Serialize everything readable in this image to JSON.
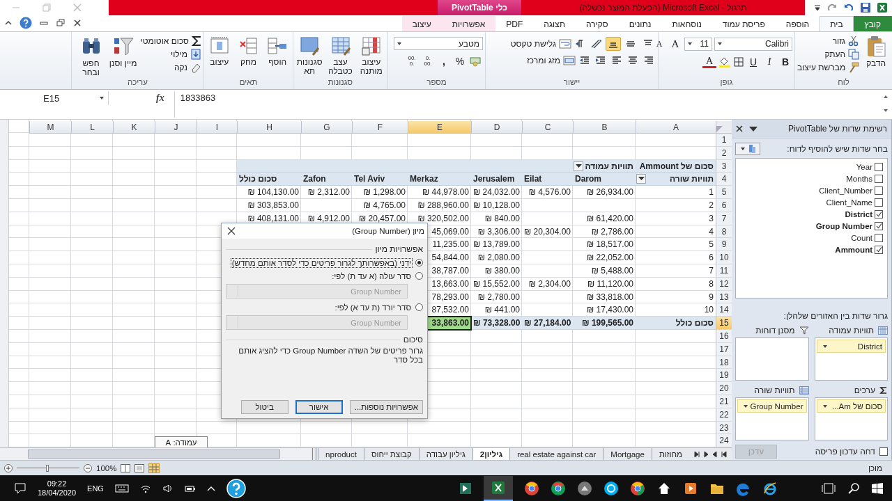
{
  "window": {
    "title": "תרגול - Microsoft Excel (הפעלת המוצר נכשלה)",
    "context_tab": "כלי PivotTable"
  },
  "tabs": [
    {
      "label": "קובץ",
      "kind": "file",
      "selected": false
    },
    {
      "label": "בית",
      "kind": "normal",
      "selected": true
    },
    {
      "label": "הוספה",
      "kind": "normal",
      "selected": false
    },
    {
      "label": "פריסת עמוד",
      "kind": "normal",
      "selected": false
    },
    {
      "label": "נוסחאות",
      "kind": "normal",
      "selected": false
    },
    {
      "label": "נתונים",
      "kind": "normal",
      "selected": false
    },
    {
      "label": "סקירה",
      "kind": "normal",
      "selected": false
    },
    {
      "label": "תצוגה",
      "kind": "normal",
      "selected": false
    },
    {
      "label": "PDF",
      "kind": "normal",
      "selected": false
    },
    {
      "label": "אפשרויות",
      "kind": "context",
      "selected": false
    },
    {
      "label": "עיצוב",
      "kind": "context",
      "selected": false
    }
  ],
  "ribbon": {
    "clipboard": {
      "label": "לוח",
      "paste": "הדבק",
      "cut": "גזור",
      "copy": "העתק",
      "format_painter": "מברשת עיצוב"
    },
    "font": {
      "label": "גופן",
      "name": "Calibri",
      "size": "11",
      "grow": "A",
      "shrink": "A",
      "bold": "B",
      "italic": "I",
      "underline": "U",
      "font_color": "A"
    },
    "alignment": {
      "label": "יישור",
      "vertical": [
        {
          "selected": false
        },
        {
          "selected": false
        },
        {
          "selected": true
        }
      ],
      "wrap_text": "גלישת טקסט",
      "merge_center": "מזג ומרכז"
    },
    "number": {
      "label": "מספר",
      "format": "מטבע",
      "percent": "%",
      "comma": ",",
      "increase_decimal": [
        ".0",
        ".00"
      ],
      "decrease_decimal": [
        ".00",
        ".0"
      ]
    },
    "styles": {
      "label": "סגנונות",
      "buttons": [
        "עיצוב מותנה",
        "עצב כטבלה",
        "סגנונות תא"
      ]
    },
    "cells": {
      "label": "תאים",
      "buttons": [
        "הוסף",
        "מחק",
        "עיצוב"
      ]
    },
    "editing": {
      "label": "עריכה",
      "autosum": "סכום אוטומטי",
      "fill": "מילוי",
      "clear": "נקה",
      "sort_filter": "מיין וסנן",
      "find_select": "חפש ובחר"
    }
  },
  "formula_bar": {
    "name_box": "E15",
    "fx": "fx",
    "formula": "1833863"
  },
  "sheet": {
    "columns": [
      {
        "letter": "A",
        "selected": false
      },
      {
        "letter": "B",
        "selected": false
      },
      {
        "letter": "C",
        "selected": false
      },
      {
        "letter": "D",
        "selected": false
      },
      {
        "letter": "E",
        "selected": true
      },
      {
        "letter": "F",
        "selected": false
      },
      {
        "letter": "G",
        "selected": false
      },
      {
        "letter": "H",
        "selected": false
      },
      {
        "letter": "I",
        "selected": false
      },
      {
        "letter": "J",
        "selected": false
      },
      {
        "letter": "K",
        "selected": false
      },
      {
        "letter": "L",
        "selected": false
      },
      {
        "letter": "M",
        "selected": false
      }
    ],
    "rows": [
      {
        "number": "1",
        "selected": false
      },
      {
        "number": "2",
        "selected": false
      },
      {
        "number": "3",
        "selected": false,
        "cells": [
          {
            "text": "סכום של Ammount",
            "kind": "label"
          },
          {
            "text": "תוויות עמודה",
            "kind": "label",
            "dropdown": true
          },
          {
            "kind": "empty"
          },
          {
            "kind": "empty"
          },
          {
            "kind": "empty"
          },
          {
            "kind": "empty"
          },
          {
            "kind": "empty"
          },
          {
            "kind": "empty"
          }
        ]
      },
      {
        "number": "4",
        "selected": false,
        "cells": [
          {
            "text": "תוויות שורה",
            "kind": "label",
            "dropdown": true
          },
          {
            "text": "Darom",
            "kind": "header"
          },
          {
            "text": "Eilat",
            "kind": "header"
          },
          {
            "text": "Jerusalem",
            "kind": "header"
          },
          {
            "text": "Merkaz",
            "kind": "header"
          },
          {
            "text": "Tel Aviv",
            "kind": "header"
          },
          {
            "text": "Zafon",
            "kind": "header"
          },
          {
            "text": "סכום כולל",
            "kind": "header"
          }
        ]
      },
      {
        "number": "5",
        "selected": false,
        "cells": [
          {
            "text": "1",
            "kind": "value"
          },
          {
            "text": "₪ 26,934.00",
            "kind": "value"
          },
          {
            "text": "₪ 4,576.00",
            "kind": "value"
          },
          {
            "text": "₪ 24,032.00",
            "kind": "value"
          },
          {
            "text": "₪ 44,978.00",
            "kind": "value"
          },
          {
            "text": "₪ 1,298.00",
            "kind": "value"
          },
          {
            "text": "₪ 2,312.00",
            "kind": "value"
          },
          {
            "text": "₪ 104,130.00",
            "kind": "value"
          }
        ]
      },
      {
        "number": "6",
        "selected": false,
        "cells": [
          {
            "text": "2",
            "kind": "value"
          },
          {
            "kind": "empty"
          },
          {
            "kind": "empty"
          },
          {
            "text": "₪ 10,128.00",
            "kind": "value"
          },
          {
            "text": "₪ 288,960.00",
            "kind": "value"
          },
          {
            "text": "₪ 4,765.00",
            "kind": "value"
          },
          {
            "kind": "empty"
          },
          {
            "text": "₪ 303,853.00",
            "kind": "value"
          }
        ]
      },
      {
        "number": "7",
        "selected": false,
        "cells": [
          {
            "text": "3",
            "kind": "value"
          },
          {
            "text": "₪ 61,420.00",
            "kind": "value"
          },
          {
            "kind": "empty"
          },
          {
            "text": "₪ 840.00",
            "kind": "value"
          },
          {
            "text": "₪ 320,502.00",
            "kind": "value"
          },
          {
            "text": "₪ 20,457.00",
            "kind": "value"
          },
          {
            "text": "₪ 4,912.00",
            "kind": "value"
          },
          {
            "text": "₪ 408,131.00",
            "kind": "value"
          }
        ]
      },
      {
        "number": "8",
        "selected": false,
        "cells": [
          {
            "text": "4",
            "kind": "value"
          },
          {
            "text": "₪ 2,786.00",
            "kind": "value"
          },
          {
            "text": "₪ 20,304.00",
            "kind": "value"
          },
          {
            "text": "₪ 3,306.00",
            "kind": "value"
          },
          {
            "text": "45,069.00",
            "kind": "value"
          }
        ]
      },
      {
        "number": "9",
        "selected": false,
        "cells": [
          {
            "text": "5",
            "kind": "value"
          },
          {
            "text": "₪ 18,517.00",
            "kind": "value"
          },
          {
            "kind": "empty"
          },
          {
            "text": "₪ 13,789.00",
            "kind": "value"
          },
          {
            "text": "11,235.00",
            "kind": "value"
          }
        ]
      },
      {
        "number": "10",
        "selected": false,
        "cells": [
          {
            "text": "6",
            "kind": "value"
          },
          {
            "text": "₪ 22,052.00",
            "kind": "value"
          },
          {
            "kind": "empty"
          },
          {
            "text": "₪ 2,080.00",
            "kind": "value"
          },
          {
            "text": "54,844.00",
            "kind": "value"
          }
        ]
      },
      {
        "number": "11",
        "selected": false,
        "cells": [
          {
            "text": "7",
            "kind": "value"
          },
          {
            "text": "₪ 5,488.00",
            "kind": "value"
          },
          {
            "kind": "empty"
          },
          {
            "text": "₪ 380.00",
            "kind": "value"
          },
          {
            "text": "38,787.00",
            "kind": "value"
          }
        ]
      },
      {
        "number": "12",
        "selected": false,
        "cells": [
          {
            "text": "8",
            "kind": "value"
          },
          {
            "text": "₪ 11,120.00",
            "kind": "value"
          },
          {
            "text": "₪ 2,304.00",
            "kind": "value"
          },
          {
            "text": "₪ 15,552.00",
            "kind": "value"
          },
          {
            "text": "13,663.00",
            "kind": "value"
          }
        ]
      },
      {
        "number": "13",
        "selected": false,
        "cells": [
          {
            "text": "9",
            "kind": "value"
          },
          {
            "text": "₪ 33,818.00",
            "kind": "value"
          },
          {
            "kind": "empty"
          },
          {
            "text": "₪ 2,780.00",
            "kind": "value"
          },
          {
            "text": "78,293.00",
            "kind": "value"
          }
        ]
      },
      {
        "number": "14",
        "selected": false,
        "cells": [
          {
            "text": "10",
            "kind": "value"
          },
          {
            "text": "₪ 17,430.00",
            "kind": "value"
          },
          {
            "kind": "empty"
          },
          {
            "text": "₪ 441.00",
            "kind": "value"
          },
          {
            "text": "87,532.00",
            "kind": "value"
          }
        ]
      },
      {
        "number": "15",
        "selected": true,
        "cells": [
          {
            "text": "סכום כולל",
            "kind": "total",
            "selected": false
          },
          {
            "text": "₪ 199,565.00",
            "kind": "total",
            "selected": false
          },
          {
            "text": "₪ 27,184.00",
            "kind": "total",
            "selected": false
          },
          {
            "text": "₪ 73,328.00",
            "kind": "total",
            "selected": false
          },
          {
            "text": "33,863.00",
            "kind": "total",
            "selected": true
          }
        ]
      },
      {
        "number": "16",
        "selected": false
      },
      {
        "number": "17",
        "selected": false
      },
      {
        "number": "18",
        "selected": false
      },
      {
        "number": "19",
        "selected": false
      },
      {
        "number": "20",
        "selected": false
      },
      {
        "number": "21",
        "selected": false
      },
      {
        "number": "22",
        "selected": false
      },
      {
        "number": "23",
        "selected": false
      },
      {
        "number": "24",
        "selected": false
      }
    ],
    "tooltip": "עמודה: A",
    "tabs": [
      {
        "label": "מחוזות",
        "selected": false
      },
      {
        "label": "Mortgage",
        "selected": false
      },
      {
        "label": "real estate against car",
        "selected": false
      },
      {
        "label": "גיליון2",
        "selected": true
      },
      {
        "label": "גיליון עבודה",
        "selected": false
      },
      {
        "label": "קבוצת ייחוס",
        "selected": false
      },
      {
        "label": "nproduct",
        "selected": false
      }
    ]
  },
  "sort_dialog": {
    "title": "מיון (Group Number)",
    "section": "אפשרויות מיון",
    "options": [
      {
        "label": "ידני (באפשרותך לגרור פריטים כדי לסדר אותם מחדש)",
        "selected": true
      },
      {
        "label": "סדר עולה (א עד ת) לפי:",
        "selected": false,
        "field": "Group Number"
      },
      {
        "label": "סדר יורד (ת עד א) לפי:",
        "selected": false,
        "field": "Group Number"
      }
    ],
    "summary_title": "סיכום",
    "summary": "גרור פריטים של השדה Group Number כדי להציג אותם בכל סדר",
    "buttons": [
      {
        "label": "אפשרויות נוספות...",
        "kind": "normal"
      },
      {
        "label": "אישור",
        "kind": "default"
      },
      {
        "label": "ביטול",
        "kind": "normal"
      }
    ]
  },
  "field_list": {
    "title": "רשימת שדות של PivotTable",
    "prompt": "בחר שדות שיש להוסיף לדוח:",
    "fields": [
      {
        "name": "Year",
        "checked": false
      },
      {
        "name": "Months",
        "checked": false
      },
      {
        "name": "Client_Number",
        "checked": false
      },
      {
        "name": "Client_Name",
        "checked": false
      },
      {
        "name": "District",
        "checked": true
      },
      {
        "name": "Group Number",
        "checked": true
      },
      {
        "name": "Count",
        "checked": false
      },
      {
        "name": "Ammount",
        "checked": true
      }
    ],
    "drag_prompt": "גרור שדות בין האזורים שלהלן:",
    "areas": [
      {
        "kind": "columns",
        "title": "תוויות עמודה",
        "items": [
          "District"
        ]
      },
      {
        "kind": "filter",
        "title": "מסנן דוחות"
      },
      {
        "kind": "values",
        "title": "ערכים",
        "items": [
          "סכום של Am..."
        ]
      },
      {
        "kind": "rows",
        "title": "תוויות שורה",
        "items": [
          "Group Number"
        ]
      }
    ],
    "defer": {
      "label": "דחה עדכון פריסה",
      "checked": false
    },
    "update_button": {
      "label": "עדכן",
      "disabled": true
    }
  },
  "status_bar": {
    "ready": "מוכן",
    "zoom": "100%",
    "zoom_slider": {
      "level": 0.5
    }
  },
  "taskbar": {
    "time": "09:22",
    "date": "18/04/2020",
    "language": "ENG"
  }
}
